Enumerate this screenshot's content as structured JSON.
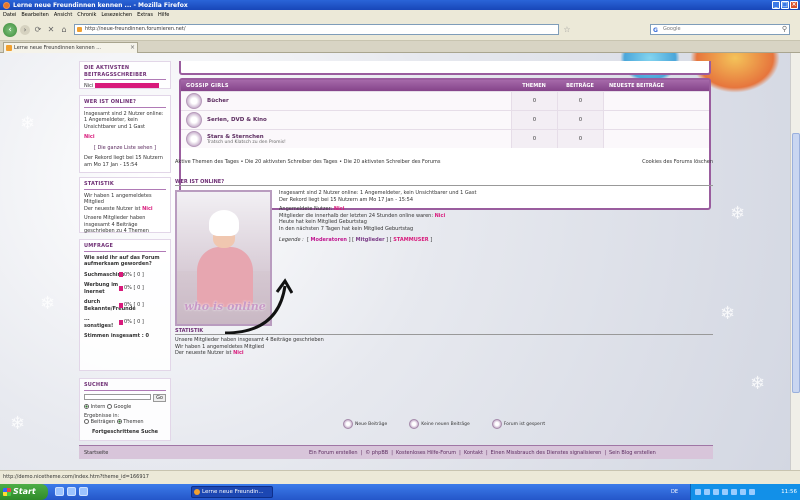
{
  "window": {
    "title": "Lerne neue Freundinnen kennen ... - Mozilla Firefox",
    "controls": [
      "_",
      "□",
      "×"
    ]
  },
  "menu": [
    "Datei",
    "Bearbeiten",
    "Ansicht",
    "Chronik",
    "Lesezeichen",
    "Extras",
    "Hilfe"
  ],
  "nav": {
    "url": "http://neue-freundinnen.forumieren.net/",
    "search_placeholder": "Google",
    "back": "‹",
    "forward": "›",
    "reload": "⟳",
    "stop": "✕",
    "home": "⌂",
    "star": "☆"
  },
  "tab": {
    "label": "Lerne neue Freundinnen kennen ...",
    "close": "×"
  },
  "sidebar": {
    "active": {
      "title": "DIE AKTIVSTEN BEITRAGSSCHREIBER",
      "user": "Nici"
    },
    "online": {
      "title": "WER IST ONLINE?",
      "text": "Insgesamt sind 2 Nutzer online: 1 Angemeldeter, kein Unsichtbarer und 1 Gast",
      "user": "Nici",
      "list_link": "[ Die ganze Liste sehen ]",
      "record": "Der Rekord liegt bei 15 Nutzern am Mo 17 Jan - 15:54"
    },
    "stats": {
      "title": "STATISTIK",
      "text1": "Wir haben 1 angemeldetes Mitglied",
      "text2_pre": "Der neueste Nutzer ist ",
      "text2_user": "Nici",
      "text3": "Unsere Mitglieder haben insgesamt 4 Beiträge geschrieben zu 4 Themen"
    },
    "poll": {
      "title": "UMFRAGE",
      "question": "Wie seid ihr auf das Forum aufmerksam geworden?",
      "options": [
        {
          "label": "Suchmaschine",
          "value": "0%",
          "count": "[ 0 ]"
        },
        {
          "label": "Werbung im Inernet",
          "value": "0%",
          "count": "[ 0 ]"
        },
        {
          "label": "durch Bekannte/Freunde",
          "value": "0%",
          "count": "[ 0 ]"
        },
        {
          "label": "... sonstiges!",
          "value": "0%",
          "count": "[ 0 ]"
        }
      ],
      "total": "Stimmen insgesamt : 0"
    },
    "search": {
      "title": "SUCHEN",
      "go": "Go",
      "opt_intern": "Intern",
      "opt_google": "Google",
      "results_in": "Ergebnisse in:",
      "res_posts": "Beiträgen",
      "res_topics": "Themen",
      "advanced": "Fortgeschrittene Suche"
    }
  },
  "forum": {
    "category": "GOSSIP GIRLS",
    "col_topics": "THEMEN",
    "col_posts": "BEITRÄGE",
    "col_latest": "NEUESTE BEITRÄGE",
    "rows": [
      {
        "title": "Bücher",
        "desc": "",
        "topics": "0",
        "posts": "0"
      },
      {
        "title": "Serien, DVD & Kino",
        "desc": "",
        "topics": "0",
        "posts": "0"
      },
      {
        "title": "Stars & Sternchen",
        "desc": "Tratsch und Klatsch zu den Promis!",
        "topics": "0",
        "posts": "0"
      }
    ]
  },
  "active_links": {
    "left": "Aktive Themen des Tages • Die 20 aktivsten Schreiber des Tages • Die 20 aktivsten Schreiber des Forums",
    "right": "Cookies des Forums löschen"
  },
  "who": {
    "title": "WER IST ONLINE?",
    "image_text": "who is online",
    "line1": "Insgesamt sind 2 Nutzer online: 1 Angemeldeter, kein Unsichtbarer und 1 Gast",
    "line2": "Der Rekord liegt bei 15 Nutzern am Mo 17 Jan - 15:54",
    "line3_pre": "Angemeldete Nutzer: ",
    "line3_user": "Nici",
    "line4_pre": "Mitglieder die innerhalb der letzten 24 Stunden online waren: ",
    "line4_user": "Nici",
    "line5": "Heute hat kein Mitglied Geburtstag",
    "line6": "In den nächsten 7 Tagen hat kein Mitglied Geburtstag",
    "legend_label": "Legende :",
    "legend_items": [
      "Moderatoren",
      "Mitglieder",
      "STAMMUSER"
    ]
  },
  "stats": {
    "title": "STATISTIK",
    "line1": "Unsere Mitglieder haben insgesamt 4 Beiträge geschrieben",
    "line2": "Wir haben 1 angemeldetes Mitglied",
    "line3_pre": "Der neueste Nutzer ist ",
    "line3_user": "Nici"
  },
  "footer_icons": [
    "Neue Beiträge",
    "Keine neuen Beiträge",
    "Forum ist gesperrt"
  ],
  "bottom": {
    "home": "Startseite",
    "links": [
      "Ein Forum erstellen",
      "|",
      "© phpBB",
      "|",
      "Kostenloses Hilfe-Forum",
      "|",
      "Kontakt",
      "|",
      "Einen Missbrauch des Dienstes signalisieren",
      "|",
      "Sein Blog erstellen"
    ]
  },
  "status": "http://demo.nicetheme.com/index.htm?theme_id=166917",
  "taskbar": {
    "start": "Start",
    "task": "Lerne neue Freundin...",
    "lang": "DE",
    "clock": "11:56"
  },
  "colors": {
    "accent": "#85448a",
    "highlight": "#d81a7b",
    "titlebar": "#1846b8"
  }
}
